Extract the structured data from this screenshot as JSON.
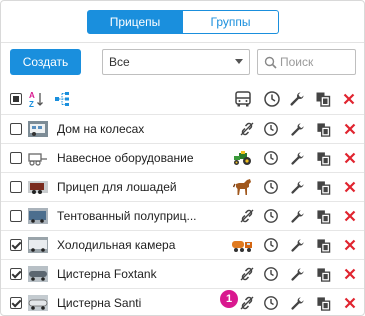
{
  "tabs": {
    "trailers": "Прицепы",
    "groups": "Группы"
  },
  "toolbar": {
    "create_label": "Создать",
    "filter_value": "Все",
    "search_placeholder": "Поиск"
  },
  "header_icons": [
    "checkbox-all-icon",
    "sort-az-icon",
    "tree-view-icon",
    "unit-bus-icon",
    "clock-icon",
    "wrench-icon",
    "copy-icon",
    "delete-icon"
  ],
  "rows": [
    {
      "name": "Дом на колесах",
      "checked": false,
      "thumb": "motorhome",
      "unit": "unlink-icon"
    },
    {
      "name": "Навесное оборудование",
      "checked": false,
      "thumb": "attachment",
      "unit": "tractor-icon"
    },
    {
      "name": "Прицеп для лошадей",
      "checked": false,
      "thumb": "horse-trailer",
      "unit": "horse-icon"
    },
    {
      "name": "Тентованный полуприц...",
      "checked": false,
      "thumb": "tent-trailer",
      "unit": "unlink-icon"
    },
    {
      "name": "Холодильная камера",
      "checked": true,
      "thumb": "fridge",
      "unit": "mixer-truck-icon"
    },
    {
      "name": "Цистерна Foxtank",
      "checked": true,
      "thumb": "tank",
      "unit": "unlink-icon"
    },
    {
      "name": "Цистерна Santi",
      "checked": true,
      "thumb": "tank2",
      "unit": "unlink-icon"
    }
  ],
  "badge": "1",
  "colors": {
    "accent": "#1a8fdd",
    "delete": "#e0242f",
    "badge": "#d9188f"
  }
}
